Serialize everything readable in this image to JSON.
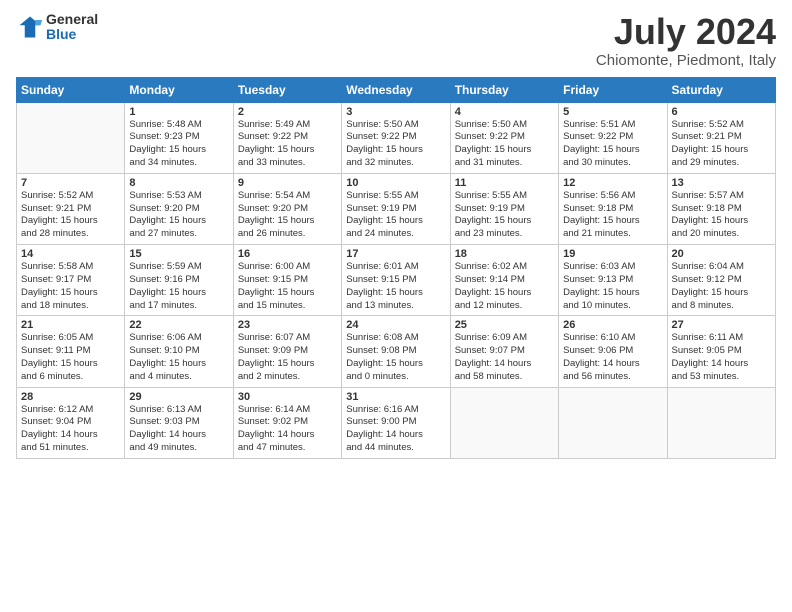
{
  "header": {
    "logo": {
      "general": "General",
      "blue": "Blue"
    },
    "title": "July 2024",
    "location": "Chiomonte, Piedmont, Italy"
  },
  "calendar": {
    "columns": [
      "Sunday",
      "Monday",
      "Tuesday",
      "Wednesday",
      "Thursday",
      "Friday",
      "Saturday"
    ],
    "weeks": [
      [
        {
          "day": "",
          "info": ""
        },
        {
          "day": "1",
          "info": "Sunrise: 5:48 AM\nSunset: 9:23 PM\nDaylight: 15 hours\nand 34 minutes."
        },
        {
          "day": "2",
          "info": "Sunrise: 5:49 AM\nSunset: 9:22 PM\nDaylight: 15 hours\nand 33 minutes."
        },
        {
          "day": "3",
          "info": "Sunrise: 5:50 AM\nSunset: 9:22 PM\nDaylight: 15 hours\nand 32 minutes."
        },
        {
          "day": "4",
          "info": "Sunrise: 5:50 AM\nSunset: 9:22 PM\nDaylight: 15 hours\nand 31 minutes."
        },
        {
          "day": "5",
          "info": "Sunrise: 5:51 AM\nSunset: 9:22 PM\nDaylight: 15 hours\nand 30 minutes."
        },
        {
          "day": "6",
          "info": "Sunrise: 5:52 AM\nSunset: 9:21 PM\nDaylight: 15 hours\nand 29 minutes."
        }
      ],
      [
        {
          "day": "7",
          "info": "Sunrise: 5:52 AM\nSunset: 9:21 PM\nDaylight: 15 hours\nand 28 minutes."
        },
        {
          "day": "8",
          "info": "Sunrise: 5:53 AM\nSunset: 9:20 PM\nDaylight: 15 hours\nand 27 minutes."
        },
        {
          "day": "9",
          "info": "Sunrise: 5:54 AM\nSunset: 9:20 PM\nDaylight: 15 hours\nand 26 minutes."
        },
        {
          "day": "10",
          "info": "Sunrise: 5:55 AM\nSunset: 9:19 PM\nDaylight: 15 hours\nand 24 minutes."
        },
        {
          "day": "11",
          "info": "Sunrise: 5:55 AM\nSunset: 9:19 PM\nDaylight: 15 hours\nand 23 minutes."
        },
        {
          "day": "12",
          "info": "Sunrise: 5:56 AM\nSunset: 9:18 PM\nDaylight: 15 hours\nand 21 minutes."
        },
        {
          "day": "13",
          "info": "Sunrise: 5:57 AM\nSunset: 9:18 PM\nDaylight: 15 hours\nand 20 minutes."
        }
      ],
      [
        {
          "day": "14",
          "info": "Sunrise: 5:58 AM\nSunset: 9:17 PM\nDaylight: 15 hours\nand 18 minutes."
        },
        {
          "day": "15",
          "info": "Sunrise: 5:59 AM\nSunset: 9:16 PM\nDaylight: 15 hours\nand 17 minutes."
        },
        {
          "day": "16",
          "info": "Sunrise: 6:00 AM\nSunset: 9:15 PM\nDaylight: 15 hours\nand 15 minutes."
        },
        {
          "day": "17",
          "info": "Sunrise: 6:01 AM\nSunset: 9:15 PM\nDaylight: 15 hours\nand 13 minutes."
        },
        {
          "day": "18",
          "info": "Sunrise: 6:02 AM\nSunset: 9:14 PM\nDaylight: 15 hours\nand 12 minutes."
        },
        {
          "day": "19",
          "info": "Sunrise: 6:03 AM\nSunset: 9:13 PM\nDaylight: 15 hours\nand 10 minutes."
        },
        {
          "day": "20",
          "info": "Sunrise: 6:04 AM\nSunset: 9:12 PM\nDaylight: 15 hours\nand 8 minutes."
        }
      ],
      [
        {
          "day": "21",
          "info": "Sunrise: 6:05 AM\nSunset: 9:11 PM\nDaylight: 15 hours\nand 6 minutes."
        },
        {
          "day": "22",
          "info": "Sunrise: 6:06 AM\nSunset: 9:10 PM\nDaylight: 15 hours\nand 4 minutes."
        },
        {
          "day": "23",
          "info": "Sunrise: 6:07 AM\nSunset: 9:09 PM\nDaylight: 15 hours\nand 2 minutes."
        },
        {
          "day": "24",
          "info": "Sunrise: 6:08 AM\nSunset: 9:08 PM\nDaylight: 15 hours\nand 0 minutes."
        },
        {
          "day": "25",
          "info": "Sunrise: 6:09 AM\nSunset: 9:07 PM\nDaylight: 14 hours\nand 58 minutes."
        },
        {
          "day": "26",
          "info": "Sunrise: 6:10 AM\nSunset: 9:06 PM\nDaylight: 14 hours\nand 56 minutes."
        },
        {
          "day": "27",
          "info": "Sunrise: 6:11 AM\nSunset: 9:05 PM\nDaylight: 14 hours\nand 53 minutes."
        }
      ],
      [
        {
          "day": "28",
          "info": "Sunrise: 6:12 AM\nSunset: 9:04 PM\nDaylight: 14 hours\nand 51 minutes."
        },
        {
          "day": "29",
          "info": "Sunrise: 6:13 AM\nSunset: 9:03 PM\nDaylight: 14 hours\nand 49 minutes."
        },
        {
          "day": "30",
          "info": "Sunrise: 6:14 AM\nSunset: 9:02 PM\nDaylight: 14 hours\nand 47 minutes."
        },
        {
          "day": "31",
          "info": "Sunrise: 6:16 AM\nSunset: 9:00 PM\nDaylight: 14 hours\nand 44 minutes."
        },
        {
          "day": "",
          "info": ""
        },
        {
          "day": "",
          "info": ""
        },
        {
          "day": "",
          "info": ""
        }
      ]
    ]
  }
}
